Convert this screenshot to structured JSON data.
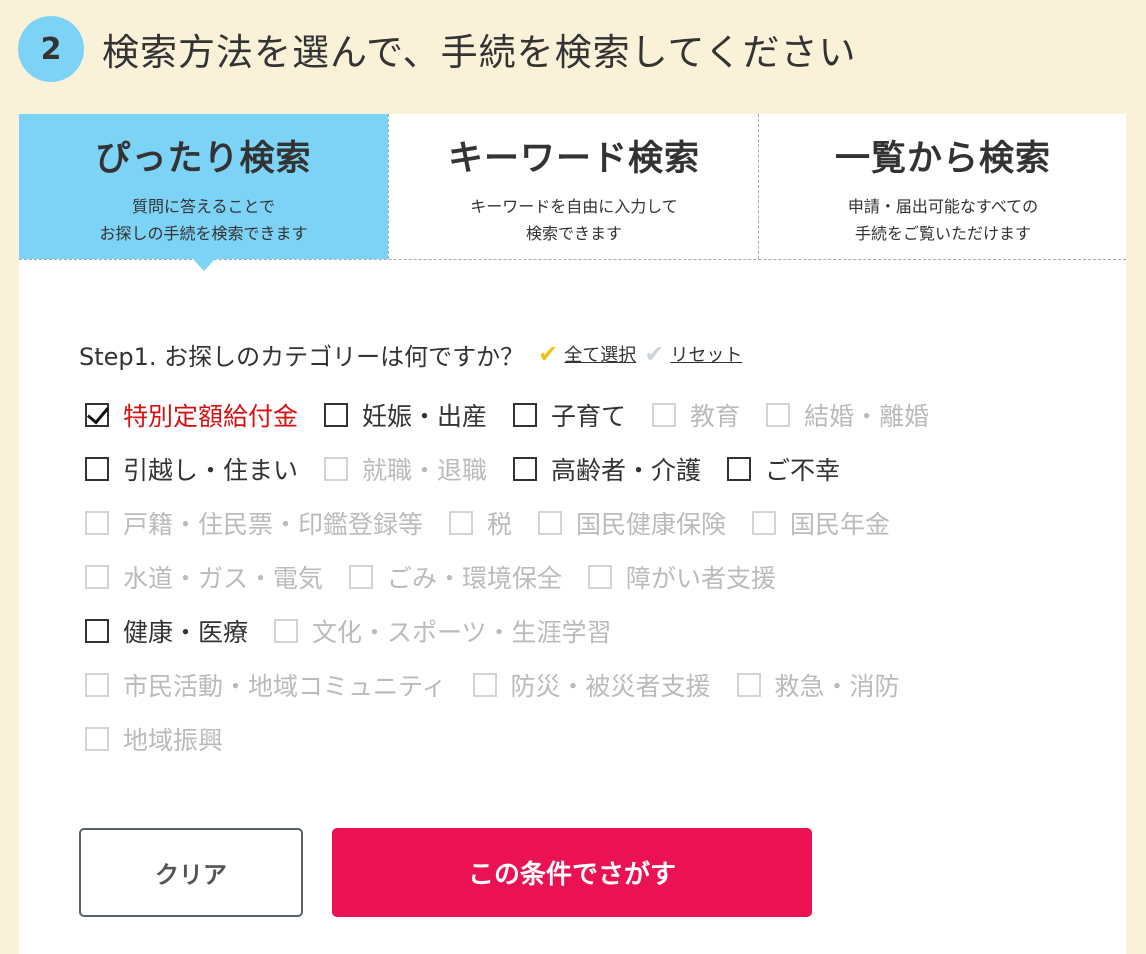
{
  "header": {
    "step_number": "2",
    "title": "検索方法を選んで、手続を検索してください"
  },
  "tabs": [
    {
      "title": "ぴったり検索",
      "desc_line1": "質問に答えることで",
      "desc_line2": "お探しの手続を検索できます",
      "active": true
    },
    {
      "title": "キーワード検索",
      "desc_line1": "キーワードを自由に入力して",
      "desc_line2": "検索できます",
      "active": false
    },
    {
      "title": "一覧から検索",
      "desc_line1": "申請・届出可能なすべての",
      "desc_line2": "手続をご覧いただけます",
      "active": false
    }
  ],
  "step1": {
    "question": "Step1. お探しのカテゴリーは何ですか？",
    "select_all": "全て選択",
    "reset": "リセット"
  },
  "categories": [
    {
      "label": "特別定額給付金",
      "checked": true,
      "enabled": true
    },
    {
      "label": "妊娠・出産",
      "checked": false,
      "enabled": true
    },
    {
      "label": "子育て",
      "checked": false,
      "enabled": true
    },
    {
      "label": "教育",
      "checked": false,
      "enabled": false
    },
    {
      "label": "結婚・離婚",
      "checked": false,
      "enabled": false
    },
    {
      "label": "引越し・住まい",
      "checked": false,
      "enabled": true
    },
    {
      "label": "就職・退職",
      "checked": false,
      "enabled": false
    },
    {
      "label": "高齢者・介護",
      "checked": false,
      "enabled": true
    },
    {
      "label": "ご不幸",
      "checked": false,
      "enabled": true
    },
    {
      "label": "戸籍・住民票・印鑑登録等",
      "checked": false,
      "enabled": false
    },
    {
      "label": "税",
      "checked": false,
      "enabled": false
    },
    {
      "label": "国民健康保険",
      "checked": false,
      "enabled": false
    },
    {
      "label": "国民年金",
      "checked": false,
      "enabled": false
    },
    {
      "label": "水道・ガス・電気",
      "checked": false,
      "enabled": false
    },
    {
      "label": "ごみ・環境保全",
      "checked": false,
      "enabled": false
    },
    {
      "label": "障がい者支援",
      "checked": false,
      "enabled": false
    },
    {
      "label": "健康・医療",
      "checked": false,
      "enabled": true
    },
    {
      "label": "文化・スポーツ・生涯学習",
      "checked": false,
      "enabled": false
    },
    {
      "label": "市民活動・地域コミュニティ",
      "checked": false,
      "enabled": false
    },
    {
      "label": "防災・被災者支援",
      "checked": false,
      "enabled": false
    },
    {
      "label": "救急・消防",
      "checked": false,
      "enabled": false
    },
    {
      "label": "地域振興",
      "checked": false,
      "enabled": false
    }
  ],
  "buttons": {
    "clear": "クリア",
    "search": "この条件でさがす"
  },
  "colors": {
    "background": "#faf1d9",
    "accent_blue": "#7dd3f5",
    "search_button": "#eb1254",
    "checked_label": "#d71111"
  }
}
